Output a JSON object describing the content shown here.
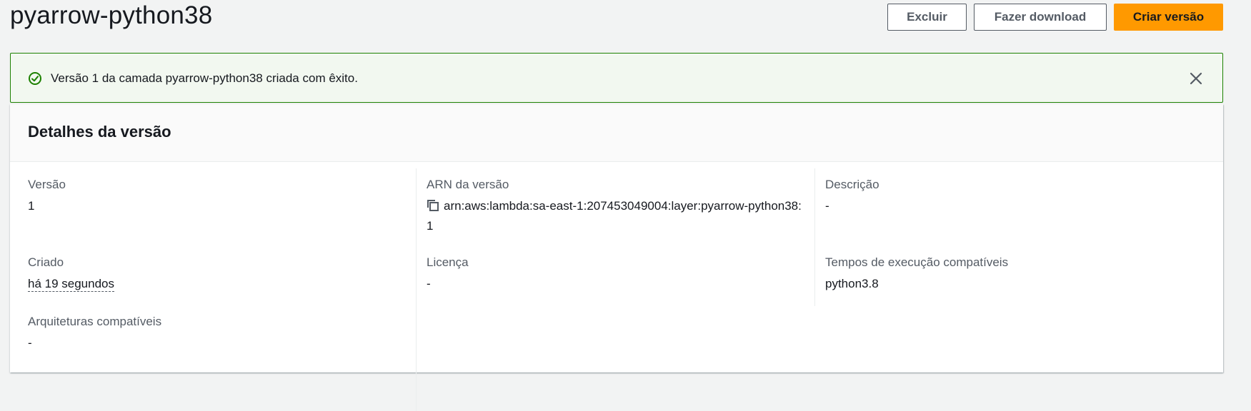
{
  "header": {
    "title": "pyarrow-python38",
    "actions": {
      "delete": "Excluir",
      "download": "Fazer download",
      "create": "Criar versão"
    }
  },
  "flash": {
    "message": "Versão 1 da camada pyarrow-python38 criada com êxito.",
    "status_color": "#1d8102",
    "icon": "success-check-icon"
  },
  "panel": {
    "title": "Detalhes da versão",
    "fields": {
      "version": {
        "label": "Versão",
        "value": "1"
      },
      "created": {
        "label": "Criado",
        "value": "há 19 segundos"
      },
      "architectures": {
        "label": "Arquiteturas compatíveis",
        "value": "-"
      },
      "arn": {
        "label": "ARN da versão",
        "value": "arn:aws:lambda:sa-east-1:207453049004:layer:pyarrow-python38:1"
      },
      "license": {
        "label": "Licença",
        "value": "-"
      },
      "description": {
        "label": "Descrição",
        "value": "-"
      },
      "runtimes": {
        "label": "Tempos de execução compatíveis",
        "value": "python3.8"
      }
    }
  },
  "colors": {
    "primary_button": "#ff9900",
    "page_background": "#f2f3f3"
  }
}
